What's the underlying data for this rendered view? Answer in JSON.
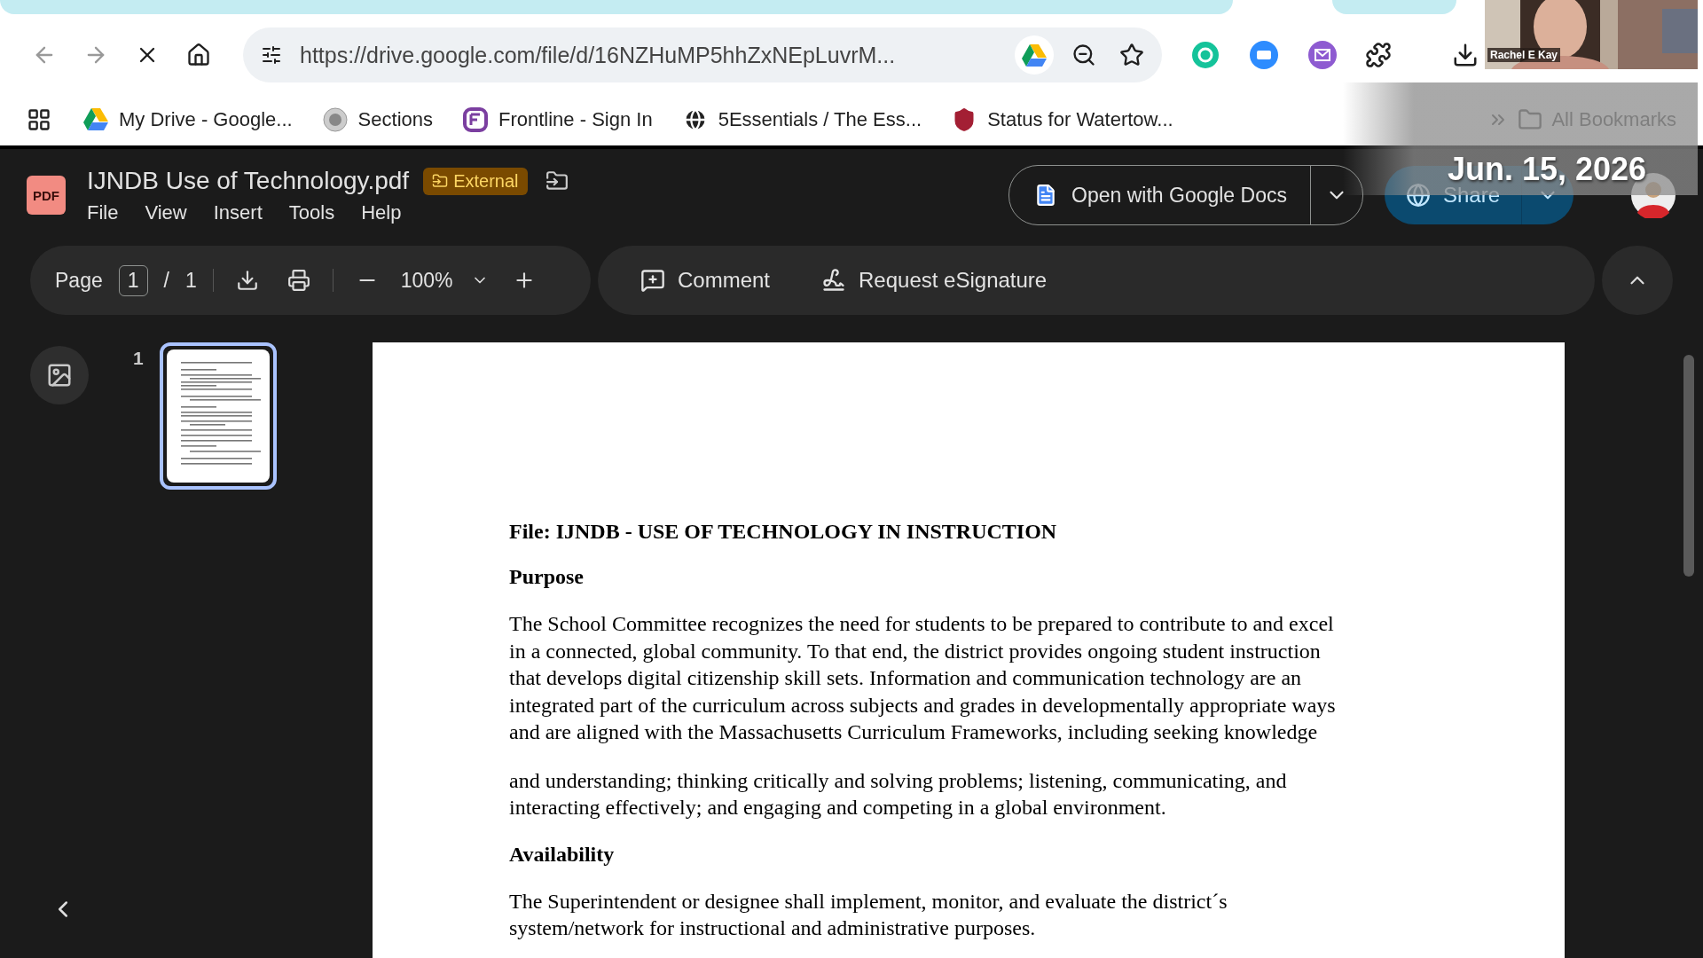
{
  "browser": {
    "url": "https://drive.google.com/file/d/16NZHuMP5hhZxNEpLuvrM..."
  },
  "bookmarks": [
    {
      "label": "My Drive - Google...",
      "kind": "drive"
    },
    {
      "label": "Sections",
      "kind": "seal"
    },
    {
      "label": "Frontline - Sign In",
      "kind": "frontline"
    },
    {
      "label": "5Essentials / The Ess...",
      "kind": "globe"
    },
    {
      "label": "Status for Watertow...",
      "kind": "shield"
    }
  ],
  "all_bookmarks": "All Bookmarks",
  "document": {
    "title": "IJNDB Use of Technology.pdf",
    "file_icon": "PDF",
    "badge": "External",
    "menu": [
      "File",
      "View",
      "Insert",
      "Tools",
      "Help"
    ],
    "open_with": "Open with Google Docs",
    "share": "Share"
  },
  "toolbar": {
    "page_label": "Page",
    "page": "1",
    "page_sep": "/",
    "page_count": "1",
    "zoom": "100%",
    "comment": "Comment",
    "esignature": "Request eSignature"
  },
  "thumbnails": [
    {
      "number": "1",
      "selected": true
    }
  ],
  "pdf": [
    {
      "kind": "heading",
      "text": "File: IJNDB - USE OF TECHNOLOGY IN INSTRUCTION"
    },
    {
      "kind": "heading",
      "text": "Purpose"
    },
    {
      "kind": "paragraph",
      "lines": [
        "The School Committee recognizes the need for students to be prepared to contribute to and excel",
        "in a connected, global community. To that end, the district provides ongoing student instruction",
        "that develops digital citizenship skill sets. Information and communication technology are an",
        "integrated part of the curriculum across subjects and grades in developmentally appropriate ways",
        "and are aligned with the Massachusetts Curriculum Frameworks, including seeking knowledge"
      ]
    },
    {
      "kind": "paragraph",
      "lines": [
        "and understanding; thinking critically and solving problems; listening, communicating, and",
        "interacting effectively; and engaging and competing in a global environment."
      ]
    },
    {
      "kind": "heading",
      "text": "Availability"
    },
    {
      "kind": "paragraph",
      "lines": [
        "The Superintendent or designee shall implement, monitor, and evaluate the district´s",
        "system/network for instructional and administrative purposes."
      ]
    }
  ],
  "webcam": {
    "name": "Rachel E Kay"
  },
  "overlay": {
    "date": "Jun. 15, 2026"
  }
}
